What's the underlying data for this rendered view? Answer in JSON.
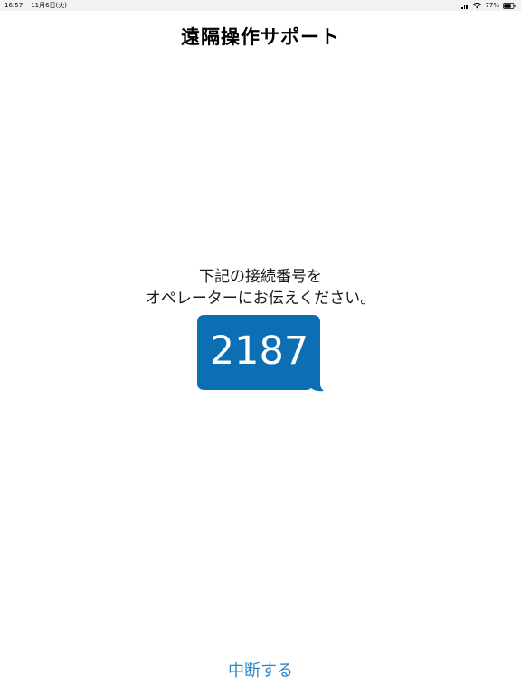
{
  "status_bar": {
    "time": "16:57",
    "date": "11月6日(火)",
    "battery_percent": "77%",
    "battery_level": 0.77,
    "icons": [
      "signal-icon",
      "wifi-icon",
      "battery-icon"
    ]
  },
  "header": {
    "title": "遠隔操作サポート"
  },
  "instruction": {
    "line1": "下記の接続番号を",
    "line2": "オペレーターにお伝えください。"
  },
  "code": {
    "value": "2187"
  },
  "actions": {
    "cancel_label": "中断する"
  },
  "colors": {
    "bubble": "#0d6fb3",
    "link": "#2b87c8"
  }
}
